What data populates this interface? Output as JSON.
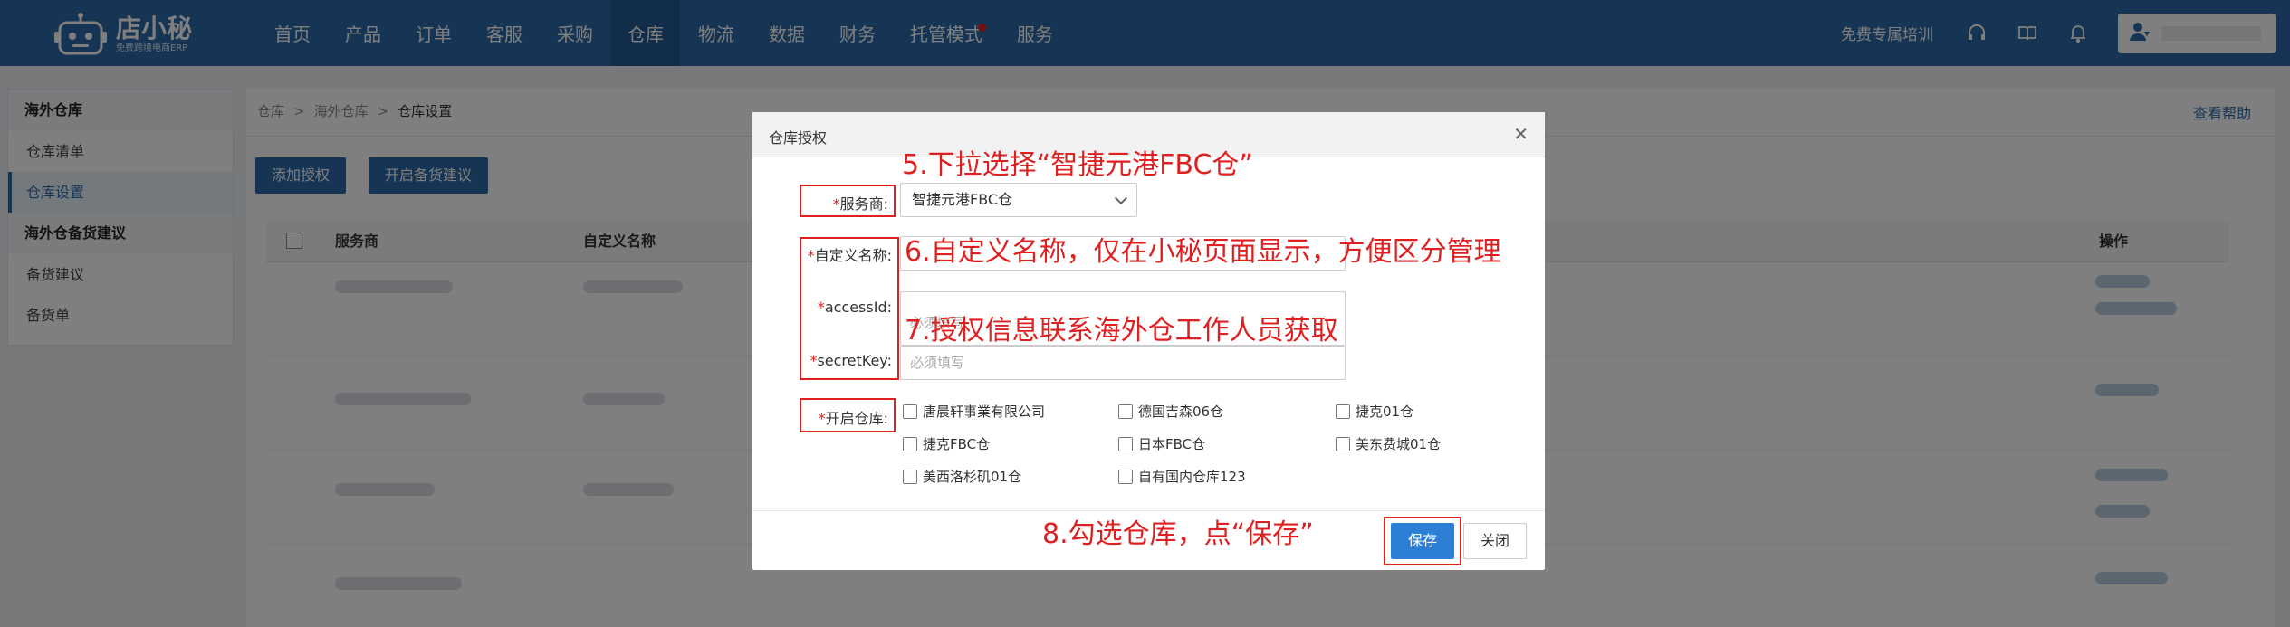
{
  "brand": {
    "name": "店小秘",
    "tagline": "免费跨境电商ERP"
  },
  "nav": [
    {
      "label": "首页"
    },
    {
      "label": "产品"
    },
    {
      "label": "订单"
    },
    {
      "label": "客服"
    },
    {
      "label": "采购"
    },
    {
      "label": "仓库",
      "active": true
    },
    {
      "label": "物流"
    },
    {
      "label": "数据"
    },
    {
      "label": "财务"
    },
    {
      "label": "托管模式",
      "badge": true
    },
    {
      "label": "服务"
    }
  ],
  "topright": {
    "training": "免费专属培训"
  },
  "sidebar": {
    "group1": "海外仓库",
    "items1": [
      "仓库清单",
      "仓库设置"
    ],
    "group2": "海外仓备货建议",
    "items2": [
      "备货建议",
      "备货单"
    ]
  },
  "main": {
    "breadcrumb": [
      "仓库",
      "海外仓库",
      "仓库设置"
    ],
    "help": "查看帮助",
    "add_button": "添加授权",
    "stock_button": "开启备货建议",
    "table_headers": {
      "provider": "服务商",
      "custom_name": "自定义名称",
      "actions": "操作"
    }
  },
  "modal": {
    "title": "仓库授权",
    "provider_label": "服务商:",
    "provider_value": "智捷元港FBC仓",
    "custom_name_label": "自定义名称:",
    "access_label": "accessId:",
    "access_placeholder": "必须填写",
    "secret_label": "secretKey:",
    "secret_placeholder": "必须填写",
    "warehouse_label": "开启仓库:",
    "warehouses": [
      "唐晨轩事業有限公司",
      "德国吉森06仓",
      "捷克01仓",
      "捷克FBC仓",
      "日本FBC仓",
      "美东费城01仓",
      "美西洛杉矶01仓",
      "自有国内仓库123"
    ],
    "save": "保存",
    "close": "关闭"
  },
  "annotations": {
    "a5": "5.下拉选择“智捷元港FBC仓”",
    "a6": "6.自定义名称，仅在小秘页面显示，方便区分管理",
    "a7": "7.授权信息联系海外仓工作人员获取",
    "a8": "8.勾选仓库，点“保存”"
  },
  "colors": {
    "nav_bg": "#2d6ba8",
    "primary": "#2d7fd6",
    "annotation": "#e02020"
  }
}
